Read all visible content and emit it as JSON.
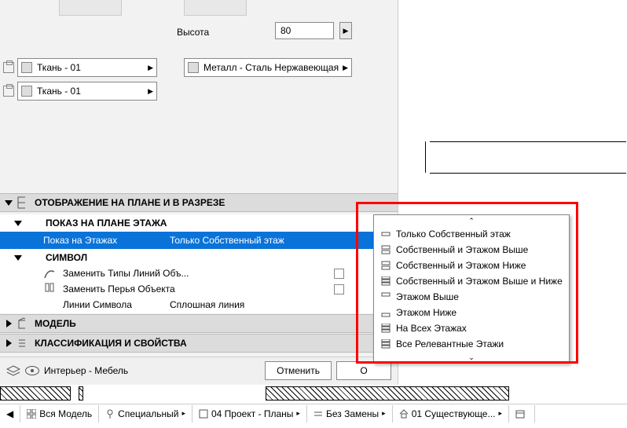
{
  "top": {
    "height_label": "Высота",
    "height_value": "80"
  },
  "materials": {
    "fabric": "Ткань - 01",
    "metal": "Металл - Сталь Нержавеющая"
  },
  "sections": {
    "display_header": "ОТОБРАЖЕНИЕ НА ПЛАНЕ И В РАЗРЕЗЕ",
    "floor_plan_show": "ПОКАЗ НА ПЛАНЕ ЭТАЖА",
    "show_on_floors_label": "Показ на Этажах",
    "show_on_floors_value": "Только Собственный этаж",
    "symbol_header": "СИМВОЛ",
    "replace_line_types": "Заменить Типы Линий Объ...",
    "replace_pens": "Заменить Перья Объекта",
    "symbol_lines": "Линии Символа",
    "symbol_lines_value": "Сплошная линия",
    "model_header": "МОДЕЛЬ",
    "classification_header": "КЛАССИФИКАЦИЯ И СВОЙСТВА"
  },
  "footer": {
    "layer_name": "Интерьер - Мебель",
    "cancel": "Отменить",
    "ok": "О"
  },
  "dropdown": [
    "Только Собственный этаж",
    "Собственный и Этажом Выше",
    "Собственный и Этажом Ниже",
    "Собственный и Этажом Выше и Ниже",
    "Этажом Выше",
    "Этажом Ниже",
    "На Всех Этажах",
    "Все Релевантные Этажи"
  ],
  "tabs": [
    "Вся Модель",
    "Специальный",
    "04 Проект - Планы",
    "Без Замены",
    "01 Существующе..."
  ]
}
